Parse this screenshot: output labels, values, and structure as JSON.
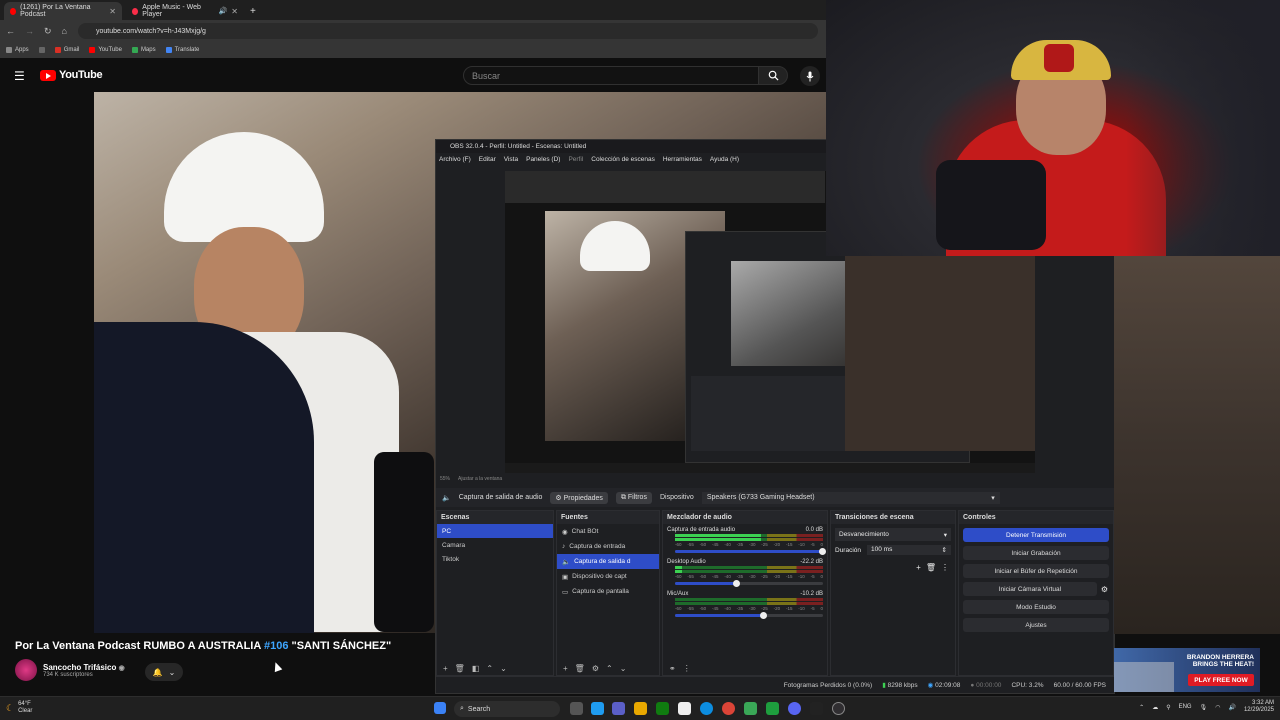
{
  "browser": {
    "tabs": [
      {
        "label": "(1261) Por La Ventana Podcast",
        "active": true
      },
      {
        "label": "Apple Music - Web Player",
        "active": false
      }
    ],
    "url": "youtube.com/watch?v=h-J43Mxjg/g",
    "bookmarks": [
      "Apps",
      "Gmail",
      "YouTube",
      "Maps",
      "Translate"
    ]
  },
  "youtube": {
    "logo": "YouTube",
    "search_placeholder": "Buscar",
    "video_title_pre": "Por La Ventana Podcast RUMBO A AUSTRALIA ",
    "video_title_hash": "#106",
    "video_title_post": " \"SANTI SÁNCHEZ\"",
    "channel_name": "Sancocho Trifásico",
    "subscribers": "734 K suscriptores"
  },
  "obs": {
    "title": "OBS 32.0.4 - Perfil: Untitled - Escenas: Untitled",
    "menu": [
      "Archivo (F)",
      "Editar",
      "Vista",
      "Paneles (D)",
      "Perfil",
      "Colección de escenas",
      "Herramientas",
      "Ayuda (H)"
    ],
    "preview_zoom": "55%",
    "preview_fit": "Ajustar a la ventana",
    "toolbar": {
      "source_label": "Captura de salida de audio",
      "properties": "Propiedades",
      "filters": "Filtros",
      "device_label": "Dispositivo",
      "device_value": "Speakers (G733 Gaming Headset)"
    },
    "panels": {
      "scenes": "Escenas",
      "sources": "Fuentes",
      "mixer": "Mezclador de audio",
      "transitions": "Transiciones de escena",
      "controls": "Controles"
    },
    "scenes": [
      "PC",
      "Camara",
      "Tiktok"
    ],
    "sources": [
      "Chat BOt",
      "Captura de entrada",
      "Captura de salida d",
      "Dispositivo de capt",
      "Captura de pantalla"
    ],
    "mixer": [
      {
        "name": "Captura de entrada audio",
        "db": "0.0 dB",
        "level": 0.58,
        "volume": 1.0
      },
      {
        "name": "Desktop Audio",
        "db": "-22.2 dB",
        "level": 0.05,
        "volume": 0.42
      },
      {
        "name": "Mic/Aux",
        "db": "-10.2 dB",
        "level": 0.0,
        "volume": 0.6
      }
    ],
    "meter_scale": [
      "-60",
      "-55",
      "-50",
      "-45",
      "-40",
      "-35",
      "-30",
      "-25",
      "-20",
      "-15",
      "-10",
      "-5",
      "0"
    ],
    "transition": {
      "type": "Desvanecimiento",
      "duration_label": "Duración",
      "duration": "100 ms"
    },
    "controls": [
      "Detener Transmisión",
      "Iniciar Grabación",
      "Iniciar el Búfer de Repetición",
      "Iniciar Cámara Virtual",
      "Modo Estudio",
      "Ajustes"
    ],
    "status": {
      "dropped": "Fotogramas Perdidos 0 (0.0%)",
      "bitrate": "8298 kbps",
      "stream_time": "02:09:08",
      "rec_time": "00:00:00",
      "cpu": "CPU: 3.2%",
      "fps": "60.00 / 60.00 FPS"
    }
  },
  "ad": {
    "line1": "BRANDON HERRERA",
    "line2": "BRINGS THE HEAT!",
    "cta": "PLAY FREE NOW"
  },
  "taskbar": {
    "temp": "64°F",
    "weather": "Clear",
    "search": "Search",
    "lang": "ENG",
    "time": "3:32 AM",
    "date": "12/29/2025"
  },
  "colors": {
    "accent": "#2e4dc8",
    "youtube_red": "#ff0000",
    "link": "#3ea6ff"
  }
}
